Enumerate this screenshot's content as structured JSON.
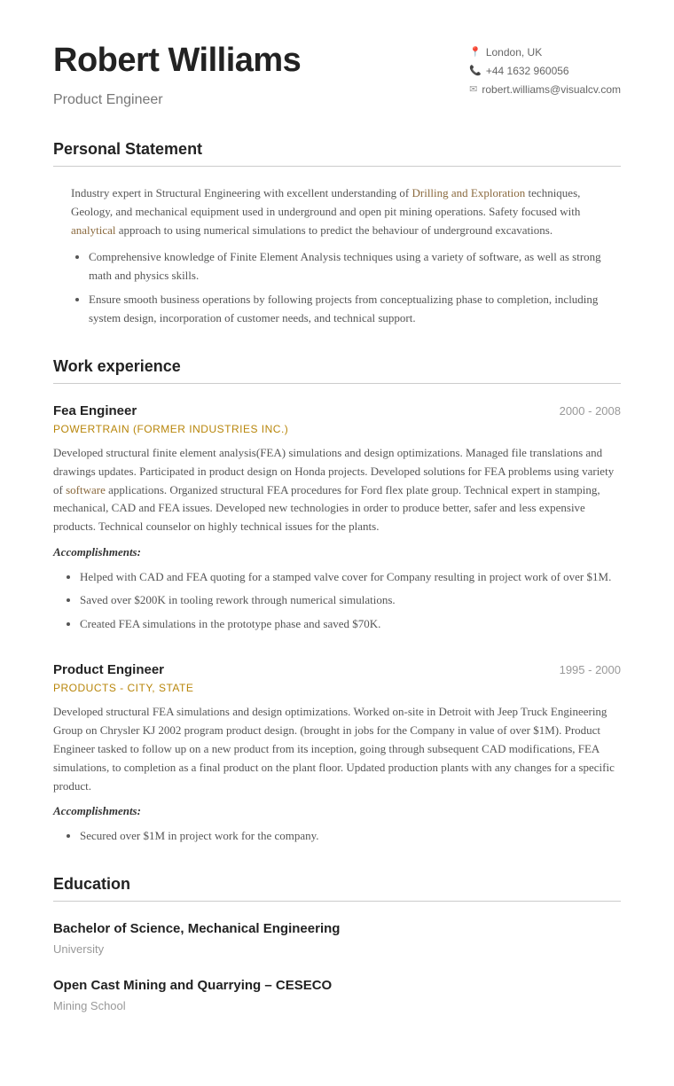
{
  "header": {
    "name": "Robert Williams",
    "title": "Product Engineer",
    "contact": {
      "location": "London, UK",
      "phone": "+44 1632 960056",
      "email": "robert.williams@visualcv.com"
    }
  },
  "sections": {
    "personal_statement": {
      "title": "Personal Statement",
      "paragraph": "Industry expert in Structural Engineering with excellent understanding of Drilling and Exploration techniques, Geology, and mechanical equipment used in underground and open pit mining operations. Safety focused with analytical approach to using numerical simulations to predict the behaviour of underground excavations.",
      "bullets": [
        "Comprehensive knowledge of Finite Element Analysis techniques using a variety of software, as well as strong math and physics skills.",
        "Ensure smooth business operations by following projects from conceptualizing phase to completion, including system design, incorporation of customer needs, and technical support."
      ]
    },
    "work_experience": {
      "title": "Work experience",
      "jobs": [
        {
          "title": "Fea Engineer",
          "company": "POWERTRAIN (FORMER INDUSTRIES INC.)",
          "dates": "2000 - 2008",
          "description": "Developed structural finite element analysis(FEA) simulations and design optimizations. Managed file translations and drawings updates. Participated in product design on Honda projects. Developed solutions for FEA problems using variety of software applications. Organized structural FEA procedures for Ford flex plate group. Technical expert in stamping, mechanical, CAD and FEA issues. Developed new technologies in order to produce better, safer and less expensive products. Technical counselor on highly technical issues for the plants.",
          "accomplishments_label": "Accomplishments:",
          "accomplishments": [
            "Helped with CAD and FEA quoting for a stamped valve cover for Company resulting in project work of over $1M.",
            "Saved over $200K in tooling rework through numerical simulations.",
            "Created FEA simulations in the prototype phase and saved $70K."
          ]
        },
        {
          "title": "Product Engineer",
          "company": "PRODUCTS - CITY, STATE",
          "dates": "1995 - 2000",
          "description": "Developed structural FEA simulations and design optimizations. Worked on-site in Detroit with Jeep Truck Engineering Group on Chrysler KJ 2002 program product design. (brought in jobs for the Company in value of over $1M). Product Engineer tasked to follow up on a new product from its inception, going through subsequent CAD modifications, FEA simulations, to completion as a final product on the plant floor. Updated production plants with any changes for a specific product.",
          "accomplishments_label": "Accomplishments:",
          "accomplishments": [
            "Secured over $1M in project work for the company."
          ]
        }
      ]
    },
    "education": {
      "title": "Education",
      "entries": [
        {
          "degree": "Bachelor of Science, Mechanical Engineering",
          "school": "University"
        },
        {
          "degree": "Open Cast Mining and Quarrying – CESECO",
          "school": "Mining School"
        }
      ]
    }
  }
}
